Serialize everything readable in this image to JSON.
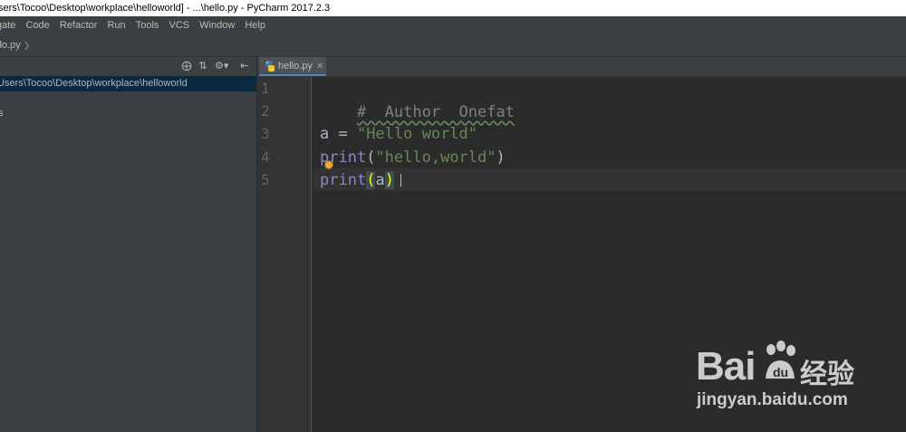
{
  "window": {
    "title": "sers\\Tocoo\\Desktop\\workplace\\helloworld] - ...\\hello.py - PyCharm 2017.2.3"
  },
  "menu": [
    "gate",
    "Code",
    "Refactor",
    "Run",
    "Tools",
    "VCS",
    "Window",
    "Help"
  ],
  "navbar": {
    "file": "llo.py"
  },
  "project": {
    "root_path": "Users\\Tocoo\\Desktop\\workplace\\helloworld",
    "external_libraries": "s"
  },
  "editor": {
    "tab_label": "hello.py",
    "line_numbers": [
      "1",
      "2",
      "3",
      "4",
      "5"
    ],
    "lines": {
      "l1_comment": "#  Author  Onefat",
      "l3_var": "a = ",
      "l3_str": "\"Hello world\"",
      "l4_func": "print",
      "l4_open": "(",
      "l4_str": "\"hello,world\"",
      "l4_close": ")",
      "l5_func": "print",
      "l5_open": "(",
      "l5_arg": "a",
      "l5_close": ")"
    }
  },
  "watermark": {
    "brand": "Bai",
    "brand_cn": "经验",
    "url": "jingyan.baidu.com"
  },
  "colors": {
    "editor_bg": "#2b2b2b",
    "panel_bg": "#3c3f41",
    "selection": "#0d293e",
    "string": "#6a8759",
    "builtin": "#8888c6",
    "comment": "#808080"
  }
}
